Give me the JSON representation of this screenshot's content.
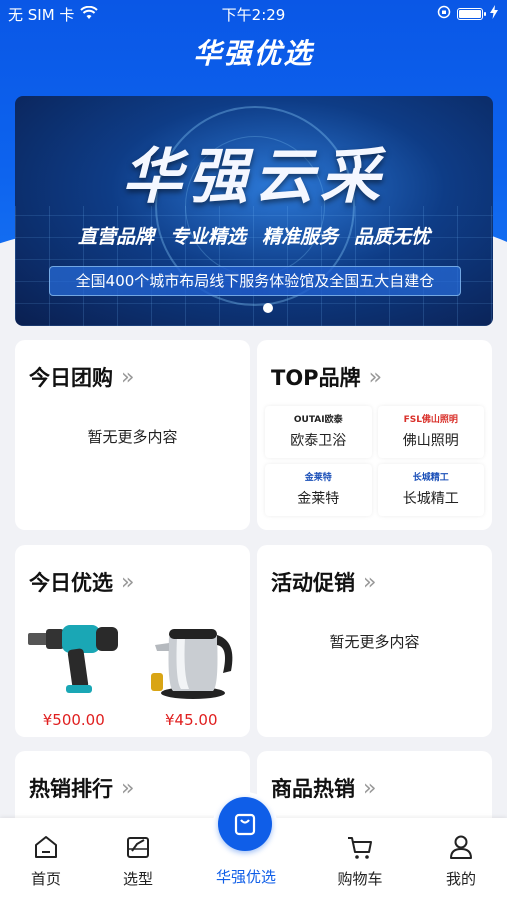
{
  "status_bar": {
    "carrier": "无 SIM 卡",
    "time": "下午2:29"
  },
  "header": {
    "title": "华强优选"
  },
  "banner": {
    "title": "华强云采",
    "slogans": [
      "直营品牌",
      "专业精选",
      "精准服务",
      "品质无忧"
    ],
    "strip_text": "全国400个城市布局线下服务体验馆及全国五大自建仓"
  },
  "sections": {
    "group_buy": {
      "title": "今日团购",
      "empty_text": "暂无更多内容"
    },
    "top_brands": {
      "title": "TOP品牌",
      "brands": [
        {
          "logo": "OUTAI欧泰",
          "name": "欧泰卫浴",
          "logo_color": "#222222"
        },
        {
          "logo": "FSL佛山照明",
          "name": "佛山照明",
          "logo_color": "#d9302a"
        },
        {
          "logo": "金莱特",
          "name": "金莱特",
          "logo_color": "#1a4fb8"
        },
        {
          "logo": "长城精工",
          "name": "长城精工",
          "logo_color": "#1a4fb8"
        }
      ]
    },
    "daily_picks": {
      "title": "今日优选",
      "products": [
        {
          "icon": "impact-wrench-image",
          "price": "¥500.00"
        },
        {
          "icon": "electric-kettle-image",
          "price": "¥45.00"
        }
      ]
    },
    "promotions": {
      "title": "活动促销",
      "empty_text": "暂无更多内容"
    },
    "hot_ranking": {
      "title": "热销排行"
    },
    "hot_products": {
      "title": "商品热销"
    }
  },
  "tabbar": {
    "items": [
      {
        "label": "首页",
        "icon": "home-icon"
      },
      {
        "label": "选型",
        "icon": "selection-icon"
      },
      {
        "label": "华强优选",
        "icon": "shopping-bag-icon"
      },
      {
        "label": "购物车",
        "icon": "cart-icon"
      },
      {
        "label": "我的",
        "icon": "user-icon"
      }
    ],
    "active_color": "#0f5ee8"
  },
  "colors": {
    "brand_blue": "#0a57e6",
    "price_red": "#e02020"
  }
}
